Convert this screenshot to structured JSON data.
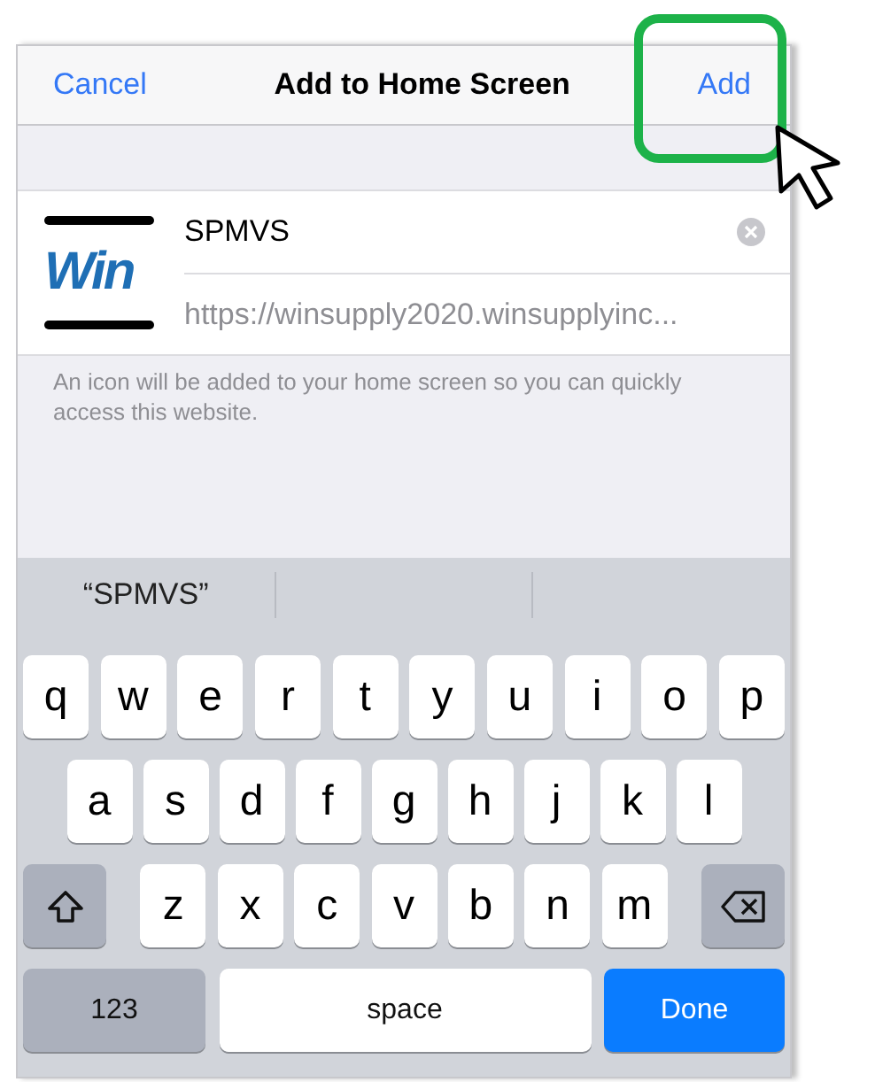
{
  "nav_bar": {
    "cancel": "Cancel",
    "title": "Add to Home Screen",
    "add": "Add"
  },
  "bookmark": {
    "icon_text": "Win",
    "name": "SPMVS",
    "url": "https://winsupply2020.winsupplyinc..."
  },
  "note": "An icon will be added to your home screen so you can quickly access this website.",
  "suggestions": [
    "“SPMVS”"
  ],
  "keyboard_rows": [
    [
      {
        "kind": "letter",
        "label": "q"
      },
      {
        "kind": "letter",
        "label": "w"
      },
      {
        "kind": "letter",
        "label": "e"
      },
      {
        "kind": "letter",
        "label": "r"
      },
      {
        "kind": "letter",
        "label": "t"
      },
      {
        "kind": "letter",
        "label": "y"
      },
      {
        "kind": "letter",
        "label": "u"
      },
      {
        "kind": "letter",
        "label": "i"
      },
      {
        "kind": "letter",
        "label": "o"
      },
      {
        "kind": "letter",
        "label": "p"
      }
    ],
    [
      {
        "kind": "letter",
        "label": "a"
      },
      {
        "kind": "letter",
        "label": "s"
      },
      {
        "kind": "letter",
        "label": "d"
      },
      {
        "kind": "letter",
        "label": "f"
      },
      {
        "kind": "letter",
        "label": "g"
      },
      {
        "kind": "letter",
        "label": "h"
      },
      {
        "kind": "letter",
        "label": "j"
      },
      {
        "kind": "letter",
        "label": "k"
      },
      {
        "kind": "letter",
        "label": "l"
      }
    ],
    [
      {
        "kind": "shift"
      },
      {
        "kind": "letter",
        "label": "z"
      },
      {
        "kind": "letter",
        "label": "x"
      },
      {
        "kind": "letter",
        "label": "c"
      },
      {
        "kind": "letter",
        "label": "v"
      },
      {
        "kind": "letter",
        "label": "b"
      },
      {
        "kind": "letter",
        "label": "n"
      },
      {
        "kind": "letter",
        "label": "m"
      },
      {
        "kind": "delete"
      }
    ],
    [
      {
        "kind": "numbers",
        "label": "123"
      },
      {
        "kind": "space",
        "label": "space"
      },
      {
        "kind": "done",
        "label": "Done"
      }
    ]
  ]
}
